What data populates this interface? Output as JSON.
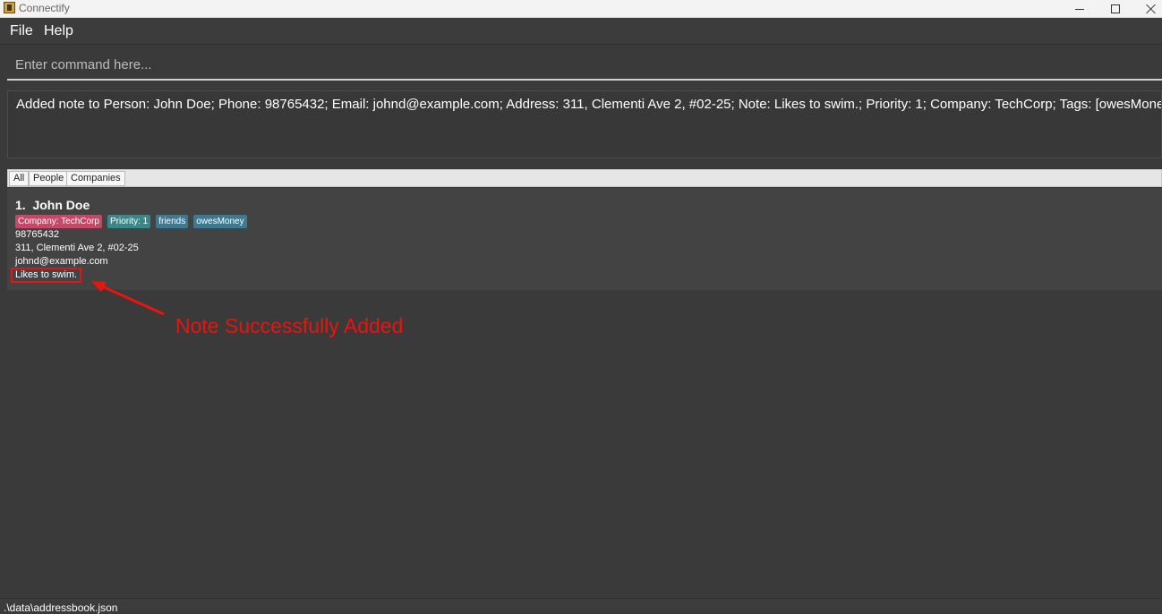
{
  "window": {
    "title": "Connectify",
    "icon": "app-icon"
  },
  "menu": {
    "items": [
      "File",
      "Help"
    ]
  },
  "command": {
    "placeholder": "Enter command here...",
    "value": ""
  },
  "result": {
    "text": "Added note to Person: John Doe; Phone: 98765432; Email: johnd@example.com; Address: 311, Clementi Ave 2, #02-25; Note: Likes to swim.; Priority: 1; Company: TechCorp; Tags: [owesMoney][friends]"
  },
  "tabs": [
    "All",
    "People",
    "Companies"
  ],
  "person": {
    "index": "1.",
    "name": "John Doe",
    "company_tag": "Company: TechCorp",
    "priority_tag": "Priority: 1",
    "tags": [
      "friends",
      "owesMoney"
    ],
    "phone": "98765432",
    "address": "311, Clementi Ave 2, #02-25",
    "email": "johnd@example.com",
    "note": "Likes to swim."
  },
  "annotation": {
    "text": "Note Successfully Added",
    "color": "#e8140f"
  },
  "status": {
    "path": ".\\data\\addressbook.json"
  }
}
